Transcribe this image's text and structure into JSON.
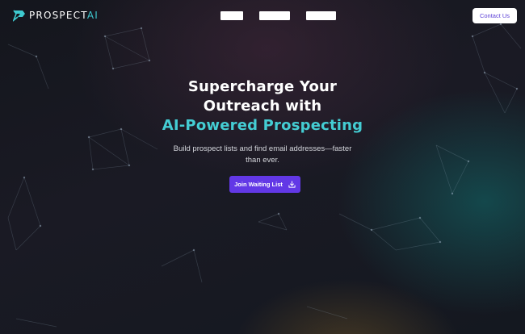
{
  "brand": {
    "name_main": "PROSPECT",
    "name_accent": "AI",
    "logo_icon": "prospect-logo-mark"
  },
  "nav": {
    "links": [
      "",
      "",
      ""
    ],
    "contact_label": "Contact Us"
  },
  "hero": {
    "title_line1": "Supercharge Your",
    "title_line2": "Outreach with",
    "title_line3": "AI-Powered Prospecting",
    "subtitle": "Build prospect lists and find email addresses—faster than ever.",
    "cta_label": "Join Waiting List",
    "cta_icon": "download-icon"
  },
  "colors": {
    "accent_teal": "#44cdd3",
    "cta_purple": "#6238e6",
    "background": "#16171f"
  }
}
